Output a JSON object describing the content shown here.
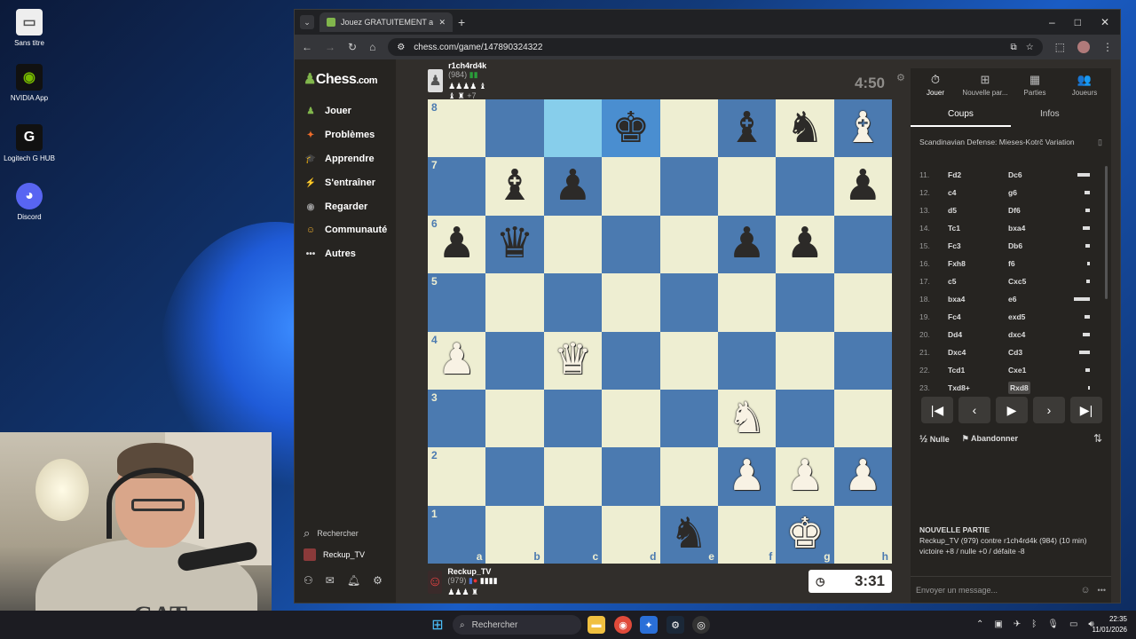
{
  "desktop": {
    "icons": [
      {
        "label": "Sans titre",
        "icon": "document-icon"
      },
      {
        "label": "NVIDIA App",
        "icon": "nvidia-icon"
      },
      {
        "label": "Logitech G HUB",
        "icon": "logitech-icon"
      },
      {
        "label": "Discord",
        "icon": "discord-icon"
      }
    ]
  },
  "browser": {
    "tab_title": "Jouez GRATUITEMENT aux éc",
    "new_tab": "+",
    "url": "chess.com/game/147890324322",
    "window_controls": [
      "–",
      "□",
      "✕"
    ]
  },
  "sidebar": {
    "logo_main": "Chess",
    "logo_suffix": ".com",
    "items": [
      {
        "label": "Jouer",
        "glyph": "♟",
        "color": "#81b64c"
      },
      {
        "label": "Problèmes",
        "glyph": "✦",
        "color": "#f06c2a"
      },
      {
        "label": "Apprendre",
        "glyph": "🎓",
        "color": "#3ba5d9"
      },
      {
        "label": "S'entraîner",
        "glyph": "⚡",
        "color": "#999"
      },
      {
        "label": "Regarder",
        "glyph": "◉",
        "color": "#999"
      },
      {
        "label": "Communauté",
        "glyph": "☺",
        "color": "#f0b030"
      },
      {
        "label": "Autres",
        "glyph": "•••",
        "color": "transparent"
      }
    ],
    "search_label": "Rechercher",
    "user_label": "Reckup_TV"
  },
  "game": {
    "top_player": {
      "name": "r1ch4rd4k",
      "rating": "(984)",
      "captured": "♟♟♟♟ ♝ ♝ ♜",
      "extra": "+7"
    },
    "top_clock": "4:50",
    "bottom_player": {
      "name": "Reckup_TV",
      "rating": "(979)",
      "captured": "♟♟♟ ♜"
    },
    "bottom_clock": "3:31",
    "ranks": [
      "8",
      "7",
      "6",
      "5",
      "4",
      "3",
      "2",
      "1"
    ],
    "files": [
      "a",
      "b",
      "c",
      "d",
      "e",
      "f",
      "g",
      "h"
    ],
    "pieces": {
      "d8": {
        "g": "♚",
        "c": "b"
      },
      "f8": {
        "g": "♝",
        "c": "b"
      },
      "g8": {
        "g": "♞",
        "c": "b"
      },
      "h8": {
        "g": "♝",
        "c": "w"
      },
      "b7": {
        "g": "♝",
        "c": "b"
      },
      "c7": {
        "g": "♟",
        "c": "b"
      },
      "h7": {
        "g": "♟",
        "c": "b"
      },
      "a6": {
        "g": "♟",
        "c": "b"
      },
      "b6": {
        "g": "♛",
        "c": "b"
      },
      "f6": {
        "g": "♟",
        "c": "b"
      },
      "g6": {
        "g": "♟",
        "c": "b"
      },
      "a4": {
        "g": "♟",
        "c": "w"
      },
      "c4": {
        "g": "♛",
        "c": "w"
      },
      "f3": {
        "g": "♞",
        "c": "w"
      },
      "f2": {
        "g": "♟",
        "c": "w"
      },
      "g2": {
        "g": "♟",
        "c": "w"
      },
      "h2": {
        "g": "♟",
        "c": "w"
      },
      "e1": {
        "g": "♞",
        "c": "b"
      },
      "g1": {
        "g": "♚",
        "c": "w"
      }
    },
    "highlights": [
      "c8",
      "d8"
    ]
  },
  "panel": {
    "tabs": [
      {
        "label": "Jouer",
        "glyph": "⏱"
      },
      {
        "label": "Nouvelle par...",
        "glyph": "⊞"
      },
      {
        "label": "Parties",
        "glyph": "▦"
      },
      {
        "label": "Joueurs",
        "glyph": "👥"
      }
    ],
    "subtabs": [
      "Coups",
      "Infos"
    ],
    "opening": "Scandinavian Defense: Mieses-Kotrč Variation",
    "moves": [
      {
        "n": "11.",
        "w": "Fd2",
        "b": "Dc6",
        "e": 14
      },
      {
        "n": "12.",
        "w": "c4",
        "b": "g6",
        "e": 6
      },
      {
        "n": "13.",
        "w": "d5",
        "b": "Df6",
        "e": 5
      },
      {
        "n": "14.",
        "w": "Tc1",
        "b": "bxa4",
        "e": 8
      },
      {
        "n": "15.",
        "w": "Fc3",
        "b": "Db6",
        "e": 5
      },
      {
        "n": "16.",
        "w": "Fxh8",
        "b": "f6",
        "e": 3
      },
      {
        "n": "17.",
        "w": "c5",
        "b": "Cxc5",
        "e": 4
      },
      {
        "n": "18.",
        "w": "bxa4",
        "b": "e6",
        "e": 18
      },
      {
        "n": "19.",
        "w": "Fc4",
        "b": "exd5",
        "e": 6
      },
      {
        "n": "20.",
        "w": "Dd4",
        "b": "dxc4",
        "e": 8
      },
      {
        "n": "21.",
        "w": "Dxc4",
        "b": "Cd3",
        "e": 12
      },
      {
        "n": "22.",
        "w": "Tcd1",
        "b": "Cxe1",
        "e": 5
      },
      {
        "n": "23.",
        "w": "Txd8+",
        "b": "Rxd8",
        "e": 2
      }
    ],
    "controls": [
      "|◀",
      "‹",
      "▶",
      "›",
      "▶|"
    ],
    "draw_label": "Nulle",
    "draw_glyph": "½",
    "resign_label": "Abandonner",
    "newgame_title": "NOUVELLE PARTIE",
    "newgame_line1": "Reckup_TV (979) contre r1ch4rd4k (984) (10 min)",
    "newgame_line2": "victoire +8 / nulle +0 / défaite -8",
    "chat_placeholder": "Envoyer un message..."
  },
  "taskbar": {
    "search": "Rechercher",
    "time": "22:35",
    "date": "11/01/2026"
  },
  "colors": {
    "board_light": "#eeeed2",
    "board_dark": "#4b7ab0",
    "highlight": "#87ceeb",
    "accent": "#81b64c"
  }
}
